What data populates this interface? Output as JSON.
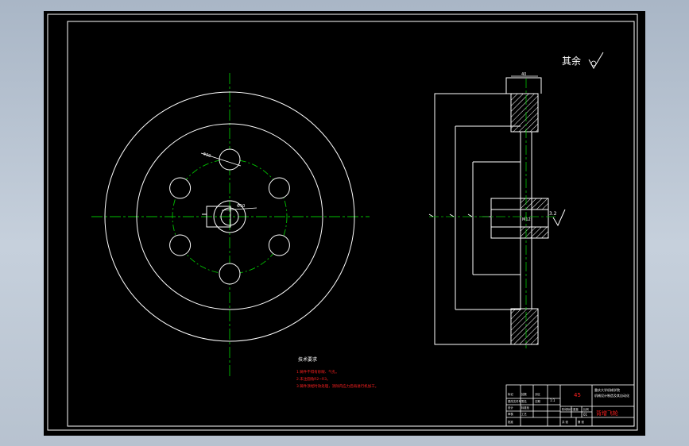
{
  "title_block_text": {
    "roughness_note": "其余",
    "tech_req_title": "技术要求",
    "tech_req_items": [
      "1.铸件不得有砂眼、气孔。",
      "2.未注圆角R2~R3。",
      "3.铸件须经时效处理，消除内应力后再进行机加工。"
    ],
    "material": "45",
    "school_line1": "重庆大学机械学院",
    "school_line2": "机械设计制造及其自动化",
    "part_name": "背增飞轮",
    "scale": "1:1",
    "block_labels": [
      "标记",
      "处数",
      "分区",
      "更改文件号",
      "签名",
      "日期",
      "设计",
      "标准化",
      "审核",
      "工艺",
      "批准",
      "阶段标记",
      "重量",
      "比例",
      "共 张",
      "第 张"
    ],
    "sheet_no": "01"
  },
  "annotations": {
    "bolt_circle_dim": "Φ90",
    "hub_dim": "Φ50",
    "thread_label": "M12",
    "width_dim": "40",
    "hub_roughness": "3.2"
  },
  "colors": {
    "background": "#000000",
    "outline": "#ffffff",
    "centerline": "#00c000",
    "red_text": "#ff2020",
    "hatch": "#ffffff"
  }
}
